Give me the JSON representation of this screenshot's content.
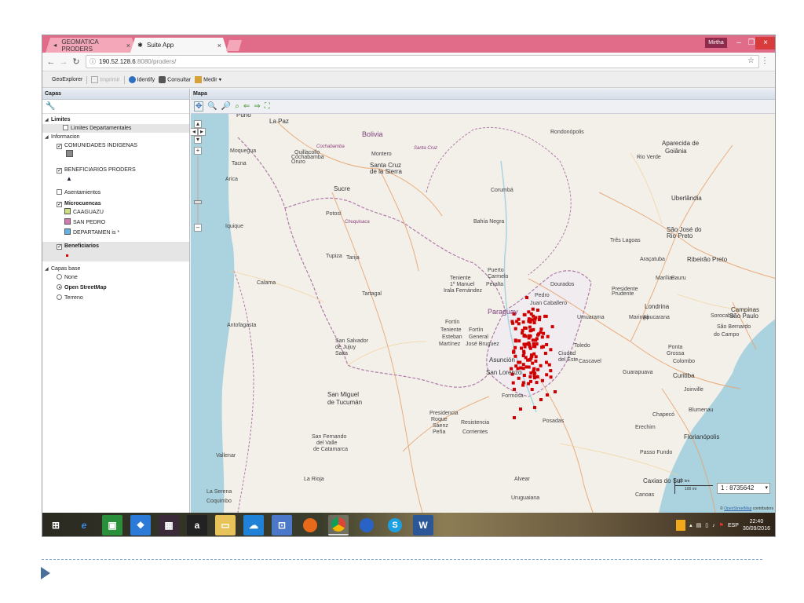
{
  "browser": {
    "tabs": [
      {
        "label": "GEOMATICA PRODERS",
        "active": false
      },
      {
        "label": "Suite App",
        "active": true
      }
    ],
    "user": "Mirtha",
    "url_host": "190.52.128.6",
    "url_path": ":8080/proders/"
  },
  "toolbar": {
    "geoexplorer": "GeoExplorer",
    "imprimir": "Imprimir",
    "identify": "Identify",
    "consultar": "Consultar",
    "medir": "Medir"
  },
  "layers_panel": {
    "title": "Capas",
    "groups": {
      "limites": {
        "label": "Limites",
        "items": [
          "Limites Departamentales"
        ]
      },
      "informacion": {
        "label": "Informacion",
        "items": {
          "comunidades": "COMUNIDADES INDIGENAS",
          "beneficiarios_proders": "BENEFICIARIOS PRODERS",
          "asentamientos": "Asentamientos",
          "microcuencas": "Microcuencas",
          "caaguazu": "CAAGUAZU",
          "san_pedro": "SAN PEDRO",
          "departamentos": "DEPARTAMEN is *",
          "beneficiarios": "Beneficiarios"
        }
      },
      "capas_base": {
        "label": "Capas base",
        "items": [
          "None",
          "Open StreetMap",
          "Terreno"
        ]
      }
    },
    "swatch_colors": {
      "comunidades": "#8a8a8a",
      "caaguazu": "#cbe07a",
      "san_pedro": "#d877b4",
      "departamentos": "#5fb3e6",
      "beneficiarios": "#e00000"
    }
  },
  "map": {
    "title": "Mapa",
    "scale_value": "1 : 8735642",
    "scale_km": "100 km",
    "scale_mi": "100 mi",
    "attribution_prefix": "©",
    "attribution_link": "OpenStreetMap",
    "attribution_suffix": "contributors",
    "labels": [
      {
        "t": "Puno",
        "c": "big"
      },
      {
        "t": "La Paz",
        "c": "big"
      },
      {
        "t": "Bolivia",
        "c": "country"
      },
      {
        "t": "Cochabamba",
        "c": "region"
      },
      {
        "t": "Santa Cruz",
        "c": "region"
      },
      {
        "t": "Quillacollo",
        "c": ""
      },
      {
        "t": "Cochabamba",
        "c": ""
      },
      {
        "t": "Oruro",
        "c": ""
      },
      {
        "t": "Montero",
        "c": ""
      },
      {
        "t": "Santa Cruz",
        "c": "big"
      },
      {
        "t": "de la Sierra",
        "c": "big"
      },
      {
        "t": "Moquegua",
        "c": ""
      },
      {
        "t": "Tacna",
        "c": ""
      },
      {
        "t": "Arica",
        "c": ""
      },
      {
        "t": "Sucre",
        "c": "big"
      },
      {
        "t": "Potosí",
        "c": ""
      },
      {
        "t": "Chuquisaca",
        "c": "region"
      },
      {
        "t": "Corumbá",
        "c": ""
      },
      {
        "t": "Bahía Negra",
        "c": ""
      },
      {
        "t": "Rondonópolis",
        "c": ""
      },
      {
        "t": "Iquique",
        "c": ""
      },
      {
        "t": "Tupiza",
        "c": ""
      },
      {
        "t": "Tarija",
        "c": ""
      },
      {
        "t": "Calama",
        "c": ""
      },
      {
        "t": "Tartagal",
        "c": ""
      },
      {
        "t": "Antofagasta",
        "c": ""
      },
      {
        "t": "San Salvador",
        "c": ""
      },
      {
        "t": "de Jujuy",
        "c": ""
      },
      {
        "t": "Salta",
        "c": ""
      },
      {
        "t": "Teniente",
        "c": ""
      },
      {
        "t": "1º Manuel",
        "c": ""
      },
      {
        "t": "Irala Fernández",
        "c": ""
      },
      {
        "t": "Puerto",
        "c": ""
      },
      {
        "t": "Carmelo",
        "c": ""
      },
      {
        "t": "Peralta",
        "c": ""
      },
      {
        "t": "Paraguay",
        "c": "country"
      },
      {
        "t": "Pedro",
        "c": ""
      },
      {
        "t": "Juan Caballero",
        "c": ""
      },
      {
        "t": "Dourados",
        "c": ""
      },
      {
        "t": "Fortín",
        "c": ""
      },
      {
        "t": "Teniente",
        "c": ""
      },
      {
        "t": "Esteban",
        "c": ""
      },
      {
        "t": "Martínez",
        "c": ""
      },
      {
        "t": "Fortín",
        "c": ""
      },
      {
        "t": "General",
        "c": ""
      },
      {
        "t": "José Bruguez",
        "c": ""
      },
      {
        "t": "Asunción",
        "c": "big"
      },
      {
        "t": "San Lorenzo",
        "c": "big"
      },
      {
        "t": "Ciudad",
        "c": ""
      },
      {
        "t": "del Este",
        "c": ""
      },
      {
        "t": "Toledo",
        "c": ""
      },
      {
        "t": "Cascavel",
        "c": ""
      },
      {
        "t": "Formosa",
        "c": ""
      },
      {
        "t": "San Miguel",
        "c": "big"
      },
      {
        "t": "de Tucumán",
        "c": "big"
      },
      {
        "t": "Presidencia",
        "c": ""
      },
      {
        "t": "Roque",
        "c": ""
      },
      {
        "t": "Sáenz",
        "c": ""
      },
      {
        "t": "Peña",
        "c": ""
      },
      {
        "t": "Resistencia",
        "c": ""
      },
      {
        "t": "Corrientes",
        "c": ""
      },
      {
        "t": "Posadas",
        "c": ""
      },
      {
        "t": "San Fernando",
        "c": ""
      },
      {
        "t": "del Valle",
        "c": ""
      },
      {
        "t": "de Catamarca",
        "c": ""
      },
      {
        "t": "La Rioja",
        "c": ""
      },
      {
        "t": "Vallenar",
        "c": ""
      },
      {
        "t": "La Serena",
        "c": ""
      },
      {
        "t": "Coquimbo",
        "c": ""
      },
      {
        "t": "Alvear",
        "c": ""
      },
      {
        "t": "Uruguaiana",
        "c": ""
      },
      {
        "t": "Goiânia",
        "c": "big"
      },
      {
        "t": "Aparecida de",
        "c": "big"
      },
      {
        "t": "Rio Verde",
        "c": ""
      },
      {
        "t": "Uberlândia",
        "c": "big"
      },
      {
        "t": "Três Lagoas",
        "c": ""
      },
      {
        "t": "São José do",
        "c": "big"
      },
      {
        "t": "Rio Preto",
        "c": "big"
      },
      {
        "t": "Ribeirão Preto",
        "c": "big"
      },
      {
        "t": "Araçatuba",
        "c": ""
      },
      {
        "t": "Marília",
        "c": ""
      },
      {
        "t": "Bauru",
        "c": ""
      },
      {
        "t": "Presidente",
        "c": ""
      },
      {
        "t": "Prudente",
        "c": ""
      },
      {
        "t": "Londrina",
        "c": "big"
      },
      {
        "t": "Maringá",
        "c": ""
      },
      {
        "t": "Apucarana",
        "c": ""
      },
      {
        "t": "Umuarama",
        "c": ""
      },
      {
        "t": "Campinas",
        "c": "big"
      },
      {
        "t": "São Paulo",
        "c": "big"
      },
      {
        "t": "Sorocaba",
        "c": ""
      },
      {
        "t": "São Bernardo",
        "c": ""
      },
      {
        "t": "do Campo",
        "c": ""
      },
      {
        "t": "Curitiba",
        "c": "big"
      },
      {
        "t": "Joinville",
        "c": ""
      },
      {
        "t": "Blumenau",
        "c": ""
      },
      {
        "t": "Florianópolis",
        "c": "big"
      },
      {
        "t": "Chapecó",
        "c": ""
      },
      {
        "t": "Erechim",
        "c": ""
      },
      {
        "t": "Passo Fundo",
        "c": ""
      },
      {
        "t": "Caxias do Sul",
        "c": "big"
      },
      {
        "t": "Canoas",
        "c": ""
      },
      {
        "t": "Guarapuava",
        "c": ""
      },
      {
        "t": "Colombo",
        "c": ""
      },
      {
        "t": "Ponta",
        "c": ""
      },
      {
        "t": "Grossa",
        "c": ""
      }
    ]
  },
  "taskbar": {
    "time": "22:40",
    "date": "30/09/2016",
    "lang": "ESP"
  },
  "colors": {
    "titlebar": "#e06c8a",
    "marker": "#d10000"
  }
}
